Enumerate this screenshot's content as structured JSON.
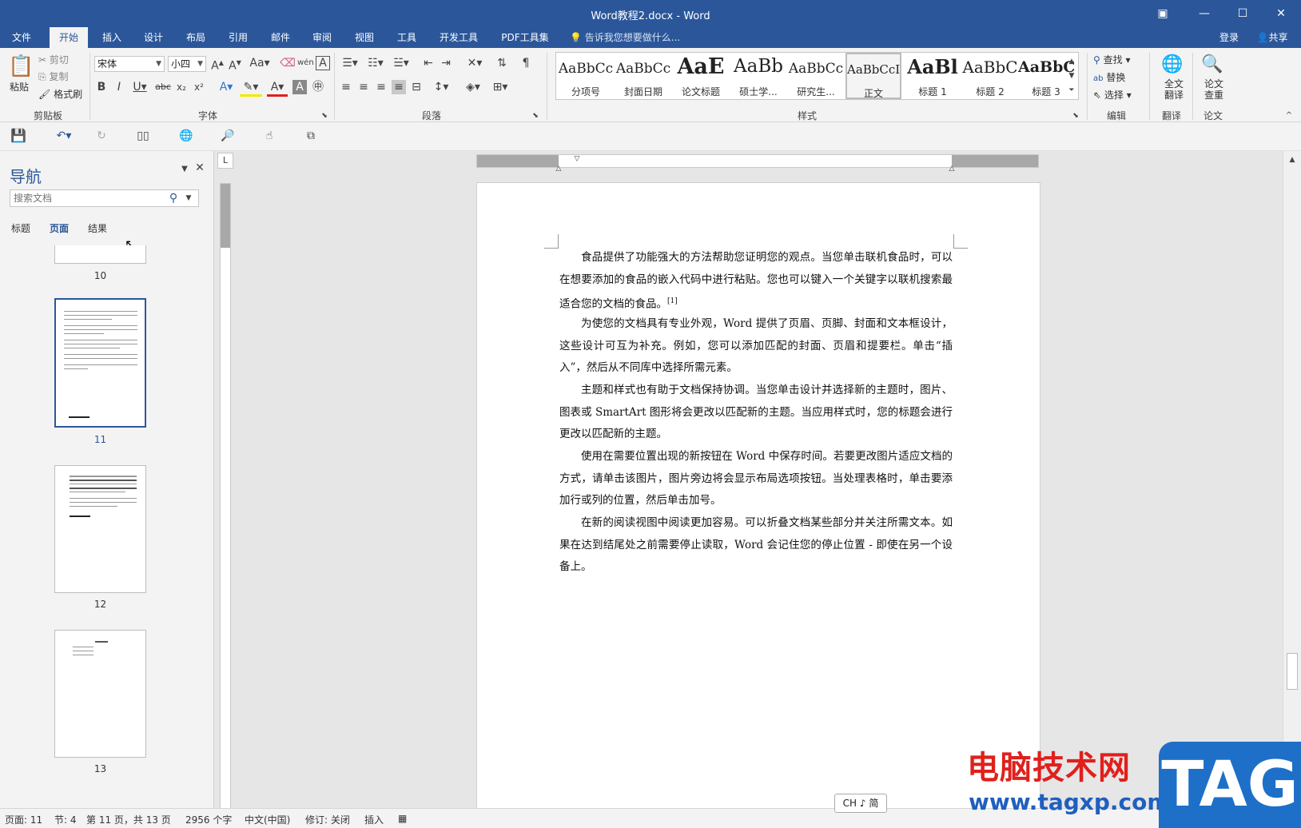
{
  "window": {
    "title": "Word教程2.docx - Word"
  },
  "tabs": [
    "文件",
    "开始",
    "插入",
    "设计",
    "布局",
    "引用",
    "邮件",
    "审阅",
    "视图",
    "工具",
    "开发工具",
    "PDF工具集"
  ],
  "tell_me": "告诉我您想要做什么...",
  "account": {
    "login": "登录",
    "share": "共享"
  },
  "ribbon": {
    "clipboard": {
      "paste": "粘贴",
      "cut": "剪切",
      "copy": "复制",
      "format_painter": "格式刷",
      "label": "剪贴板"
    },
    "font": {
      "name": "宋体",
      "size": "小四",
      "label": "字体"
    },
    "paragraph": {
      "label": "段落"
    },
    "styles": {
      "label": "样式",
      "items": [
        {
          "preview": "AaBbCc",
          "name": "分项号"
        },
        {
          "preview": "AaBbCc",
          "name": "封面日期"
        },
        {
          "preview": "AaE",
          "name": "论文标题"
        },
        {
          "preview": "AaBb",
          "name": "硕士学..."
        },
        {
          "preview": "AaBbCc",
          "name": "研究生..."
        },
        {
          "preview": "AaBbCcI",
          "name": "正文"
        },
        {
          "preview": "AaBl",
          "name": "标题 1"
        },
        {
          "preview": "AaBbC",
          "name": "标题 2"
        },
        {
          "preview": "AaBbC",
          "name": "标题 3"
        }
      ]
    },
    "editing": {
      "find": "查找",
      "replace": "替换",
      "select": "选择",
      "label": "编辑"
    },
    "translate": {
      "full": "全文翻译",
      "label": "翻译"
    },
    "paper": {
      "check": "论文查重",
      "label": "论文"
    }
  },
  "nav": {
    "title": "导航",
    "search_placeholder": "搜索文档",
    "tabs": [
      "标题",
      "页面",
      "结果"
    ],
    "pages": [
      "10",
      "11",
      "12",
      "13"
    ]
  },
  "document": {
    "paragraphs": [
      "食品提供了功能强大的方法帮助您证明您的观点。当您单击联机食品时，可以在想要添加的食品的嵌入代码中进行粘贴。您也可以键入一个关键字以联机搜索最适合您的文档的食品。",
      "为使您的文档具有专业外观，Word 提供了页眉、页脚、封面和文本框设计，这些设计可互为补充。例如，您可以添加匹配的封面、页眉和提要栏。单击“插入”，然后从不同库中选择所需元素。",
      "主题和样式也有助于文档保持协调。当您单击设计并选择新的主题时，图片、图表或 SmartArt 图形将会更改以匹配新的主题。当应用样式时，您的标题会进行更改以匹配新的主题。",
      "使用在需要位置出现的新按钮在 Word 中保存时间。若要更改图片适应文档的方式，请单击该图片，图片旁边将会显示布局选项按钮。当处理表格时，单击要添加行或列的位置，然后单击加号。",
      "在新的阅读视图中阅读更加容易。可以折叠文档某些部分并关注所需文本。如果在达到结尾处之前需要停止读取，Word 会记住您的停止位置 - 即使在另一个设备上。"
    ],
    "footnote_mark": "[1]"
  },
  "status": {
    "page": "页面: 11",
    "section": "节: 4",
    "page_of": "第 11 页，共 13 页",
    "words": "2956 个字",
    "language": "中文(中国)",
    "track": "修订: 关闭",
    "mode": "插入"
  },
  "ime": "CH ♪ 简",
  "watermark": {
    "text": "电脑技术网",
    "url": "www.tagxp.com",
    "badge": "TAG"
  },
  "colors": {
    "accent": "#2b579a",
    "watermark_red": "#e0201c",
    "watermark_blue": "#1e6fc8"
  }
}
